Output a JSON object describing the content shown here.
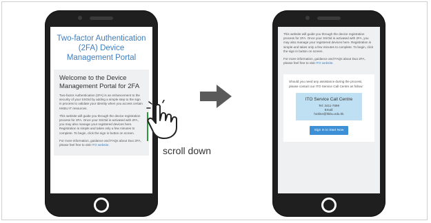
{
  "left_phone": {
    "title": "Two-factor Authentication (2FA) Device Management Portal",
    "welcome_heading": "Welcome to the Device Management Portal for 2FA",
    "para1": "Two-factor Authentication (2FA) is an enhancement to the security of your SSOid by adding a simple step to the sign in process to validate your identity when you access certain HKBU IT resources.",
    "para2": "This website will guide you through the device registration process for 2FA. Once your SSOid is activated with 2FA, you may also manage your registered devices here. Registration is simple and takes only a few minutes to complete. To begin, click the sign in button on screen.",
    "para3_prefix": "For more information, guidance and FAQs about Duo 2FA, please feel free to visit ",
    "para3_link": "ITO website."
  },
  "gesture": {
    "label": "scroll down",
    "icon": "hand-swipe-icon",
    "arrow_icon": "arrow-right-icon"
  },
  "right_phone": {
    "para1": "This website will guide you through the device registration process for 2FA. Once your SSOid is activated with 2FA, you may also manage your registered devices here. Registration is simple and takes only a few minutes to complete. To begin, click the sign in button on screen.",
    "para2_prefix": "For more information, guidance and FAQs about Duo 2FA, please feel free to visit ",
    "para2_link": "ITO website.",
    "assist_text": "Should you need any assistance during the process, please contact our ITO Service Call Centre as follow:",
    "contact_title": "ITO Service Call Centre",
    "contact_tel": "Tel: 3411-7899",
    "contact_email_label": "Email:",
    "contact_email": "hotline@hkbu.edu.hk",
    "sign_in_button": "Sign In to Start Now"
  },
  "colors": {
    "title_blue": "#3e7dbf",
    "button_blue": "#3d8fd6",
    "contact_box": "#bfe0f2",
    "indicator_green": "#2e9a3b",
    "arrow_gray": "#5a5a5a"
  }
}
